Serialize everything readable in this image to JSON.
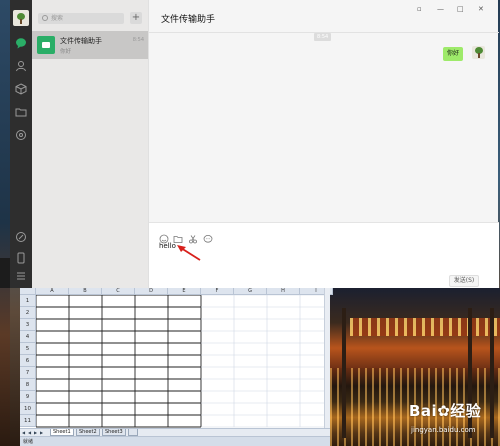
{
  "wechat": {
    "search_placeholder": "搜索",
    "add_label": "+",
    "chats": [
      {
        "name": "文件传输助手",
        "preview": "你好",
        "time": "8:54"
      }
    ],
    "chat_title": "文件传输助手",
    "window_controls": {
      "pin": "▫",
      "minimize": "—",
      "maximize": "□",
      "close": "✕"
    },
    "timestamp": "8:54",
    "messages": [
      {
        "sender": "me",
        "text": "你好"
      }
    ],
    "input_text": "hello",
    "send_label": "发送(S)",
    "accent_color": "#2aae67",
    "bubble_color": "#9eea6a"
  },
  "excel": {
    "columns": [
      "A",
      "B",
      "C",
      "D",
      "E",
      "F",
      "G",
      "H",
      "I"
    ],
    "rows": [
      "1",
      "2",
      "3",
      "4",
      "5",
      "6",
      "7",
      "8",
      "9",
      "10",
      "11"
    ],
    "sheets": [
      "Sheet1",
      "Sheet2",
      "Sheet3"
    ],
    "status_text": "就绪"
  },
  "watermark": {
    "logo": "Bai✿经验",
    "url": "jingyan.baidu.com"
  }
}
